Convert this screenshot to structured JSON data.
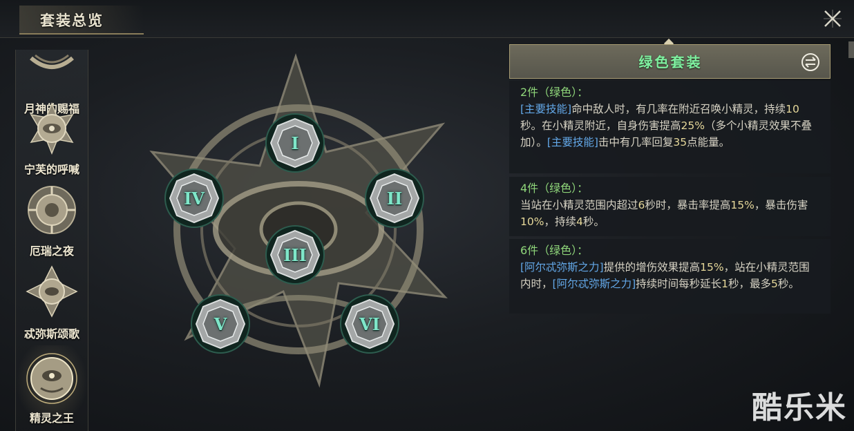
{
  "window": {
    "title": "套装总览"
  },
  "sidebar": {
    "items": [
      {
        "label": "月神的赐福",
        "active": false
      },
      {
        "label": "宁芙的呼喊",
        "active": false
      },
      {
        "label": "厄瑞之夜",
        "active": false
      },
      {
        "label": "忒弥斯颂歌",
        "active": false
      },
      {
        "label": "精灵之王",
        "active": true
      }
    ]
  },
  "pieces": {
    "p1": "I",
    "p2": "II",
    "p3": "III",
    "p4": "IV",
    "p5": "V",
    "p6": "VI"
  },
  "panel": {
    "title": "绿色套装",
    "bonuses": [
      {
        "heading": "2件（绿色）：",
        "desc_parts": [
          "[主要技能]",
          "命中敌人时，有几率在附近召唤小精灵，持续",
          "10",
          "秒。在小精灵附近，自身伤害提高",
          "25%",
          "（多个小精灵效果不叠加）。",
          "[主要技能]",
          "击中有几率回复",
          "35",
          "点能量。"
        ]
      },
      {
        "heading": "4件（绿色）：",
        "desc_parts": [
          "当站在小精灵范围内超过",
          "6",
          "秒时，暴击率提高",
          "15%",
          "，暴击伤害",
          "10%",
          "，持续",
          "4",
          "秒。"
        ]
      },
      {
        "heading": "6件（绿色）：",
        "desc_parts": [
          "[阿尔忒弥斯之力]",
          "提供的增伤效果提高",
          "15%",
          "，站在小精灵范围内时，",
          "[阿尔忒弥斯之力]",
          "持续时间每秒延长",
          "1",
          "秒，最多",
          "5",
          "秒。"
        ]
      }
    ]
  },
  "watermark": "酷乐米",
  "colors": {
    "accent_green": "#7ff0a0",
    "skill_blue": "#63a8e8",
    "number_gold": "#e6d89a",
    "piece_teal": "#7fe6c9"
  },
  "icons": {
    "close": "close-x-icon",
    "swap": "swap-icon"
  }
}
